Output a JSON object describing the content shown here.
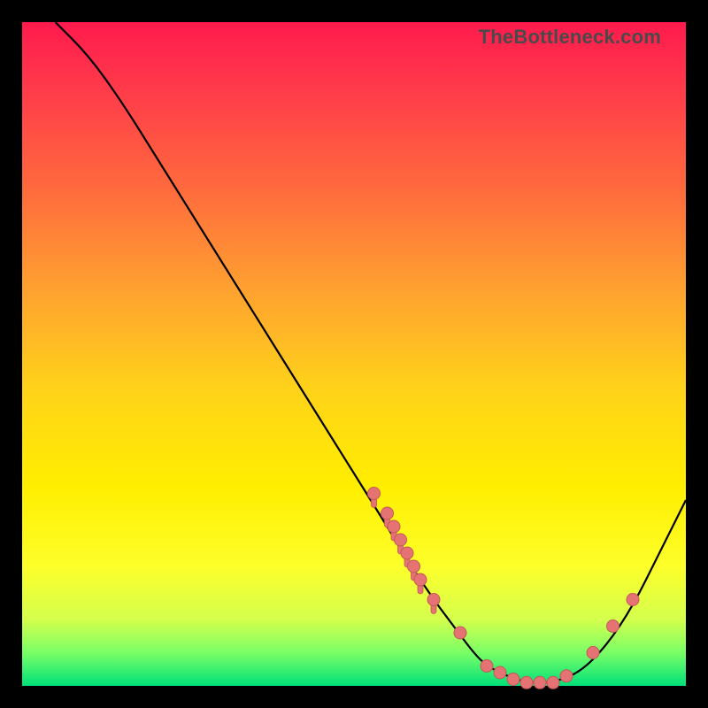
{
  "watermark": "TheBottleneck.com",
  "colors": {
    "gradient_top": "#ff1a4d",
    "gradient_bottom": "#00e07a",
    "curve": "#000000",
    "marker": "#e57373"
  },
  "chart_data": {
    "type": "line",
    "title": "",
    "xlabel": "",
    "ylabel": "",
    "xlim": [
      0,
      100
    ],
    "ylim": [
      0,
      100
    ],
    "x": [
      5,
      10,
      15,
      20,
      25,
      30,
      35,
      40,
      45,
      50,
      55,
      58,
      62,
      65,
      68,
      70,
      73,
      76,
      80,
      84,
      88,
      92,
      96,
      100
    ],
    "y": [
      100,
      95,
      88,
      80,
      72,
      64,
      56,
      48,
      40,
      32,
      24,
      19,
      13,
      9,
      5,
      3,
      1.5,
      0.5,
      0.5,
      2,
      6,
      12,
      20,
      28
    ],
    "markers_x": [
      53,
      55,
      56,
      57,
      58,
      59,
      60,
      62,
      66,
      70,
      72,
      74,
      76,
      78,
      80,
      82,
      86,
      89,
      92
    ],
    "markers_y": [
      29,
      26,
      24,
      22,
      20,
      18,
      16,
      13,
      8,
      3,
      2,
      1,
      0.5,
      0.5,
      0.5,
      1.5,
      5,
      9,
      13
    ]
  }
}
